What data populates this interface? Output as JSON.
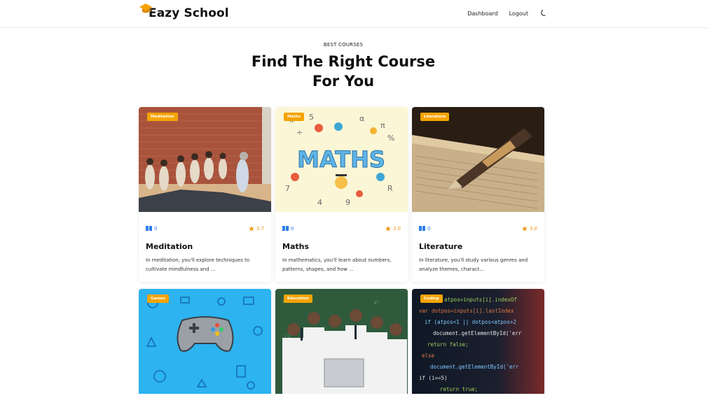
{
  "header": {
    "brand": "Eazy School",
    "nav": {
      "dashboard": "Dashboard",
      "logout": "Logout"
    },
    "icons": {
      "logo": "graduation-cap-icon",
      "theme": "moon-icon"
    }
  },
  "hero": {
    "eyebrow": "BEST COURSES",
    "title_line1": "Find The Right Course",
    "title_line2": "For You"
  },
  "courses": [
    {
      "tag": "Meditation",
      "lessons": "0",
      "rating": "3.7",
      "title": "Meditation",
      "description": "In meditation, you'll explore techniques to cultivate mindfulness and ..."
    },
    {
      "tag": "Maths",
      "lessons": "0",
      "rating": "3.0",
      "title": "Maths",
      "description": "In mathematics, you'll learn about numbers, patterns, shapes, and how ..."
    },
    {
      "tag": "Literature",
      "lessons": "0",
      "rating": "3.0",
      "title": "Literature",
      "description": "In literature, you'll study various genres and analyze themes, charact..."
    },
    {
      "tag": "Games"
    },
    {
      "tag": "Education"
    },
    {
      "tag": "Coding"
    }
  ],
  "colors": {
    "accent": "#f5a300",
    "lessons": "#2b7de9",
    "rating": "#f09a1a"
  }
}
